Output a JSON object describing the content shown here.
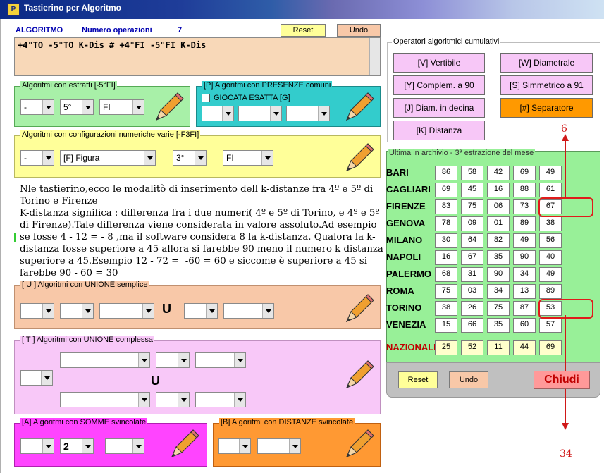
{
  "window": {
    "title": "Tastierino per Algoritmo",
    "icon_text": "P"
  },
  "header": {
    "algoritmo_label": "ALGORITMO",
    "numero_label": "Numero operazioni",
    "numero_value": "7",
    "reset_label": "Reset",
    "undo_label": "Undo"
  },
  "formula": "+4°TO -5°TO K-Dis # +4°FI -5°FI K-Dis",
  "cumulative": {
    "title": "Operatori algoritmici cumulativi",
    "buttons": [
      "[V] Vertibile",
      "[W] Diametrale",
      "[Y] Complem. a 90",
      "[S] Simmetrico  a 91",
      "[J] Diam. in decina",
      "[#] Separatore",
      "[K] Distanza"
    ]
  },
  "estratti": {
    "legend": "Algoritmi con estratti  [-5°FI]",
    "c1": "-",
    "c2": "5°",
    "c3": "FI"
  },
  "presenze": {
    "legend": "[P] Algoritmi con PRESENZE comuni",
    "checkbox_label": "GIOCATA ESATTA  [G]"
  },
  "config": {
    "legend": "Algoritmi con configurazioni numeriche varie  [-F3FI]",
    "c1": "-",
    "c2": "[F] Figura",
    "c3": "3°",
    "c4": "FI"
  },
  "note_text": "Nle tastierino,ecco le modalitò di inserimento dell k-distanze fra 4º e 5º di Torino e Firenze\nK-distanza significa : differenza fra i due numeri( 4º e 5º di Torino, e 4º e 5º di Firenze).Tale differenza viene considerata in valore assoluto.Ad esempio se fosse 4 - 12 = - 8 ,ma il software considera 8 la k-distanza. Qualora la k-distanza fosse superiore a 45 allora si farebbe 90 meno il numero k distanza superiore a 45.Esempio 12 - 72 =  -60 = 60 e siccome è superiore a 45 si farebbe 90 - 60 = 30",
  "unione": {
    "legend": "[ U ] Algoritmi con UNIONE semplice",
    "u_symbol": "U"
  },
  "unione_complessa": {
    "legend": "[ T ] Algoritmi con UNIONE complessa",
    "u_symbol": "U"
  },
  "somme": {
    "legend": "[A] Algoritmi con SOMME svincolate",
    "c2": "2"
  },
  "distanze": {
    "legend": "[B] Algoritmi con DISTANZE svincolate"
  },
  "archive": {
    "title": "Ultima in archivio - 3ª estrazione del mese",
    "rows": [
      {
        "city": "BARI",
        "nums": [
          "86",
          "58",
          "42",
          "69",
          "49"
        ]
      },
      {
        "city": "CAGLIARI",
        "nums": [
          "69",
          "45",
          "16",
          "88",
          "61"
        ]
      },
      {
        "city": "FIRENZE",
        "nums": [
          "83",
          "75",
          "06",
          "73",
          "67"
        ]
      },
      {
        "city": "GENOVA",
        "nums": [
          "78",
          "09",
          "01",
          "89",
          "38"
        ]
      },
      {
        "city": "MILANO",
        "nums": [
          "30",
          "64",
          "82",
          "49",
          "56"
        ]
      },
      {
        "city": "NAPOLI",
        "nums": [
          "16",
          "67",
          "35",
          "90",
          "40"
        ]
      },
      {
        "city": "PALERMO",
        "nums": [
          "68",
          "31",
          "90",
          "34",
          "49"
        ]
      },
      {
        "city": "ROMA",
        "nums": [
          "75",
          "03",
          "34",
          "13",
          "89"
        ]
      },
      {
        "city": "TORINO",
        "nums": [
          "38",
          "26",
          "75",
          "87",
          "53"
        ]
      },
      {
        "city": "VENEZIA",
        "nums": [
          "15",
          "66",
          "35",
          "60",
          "57"
        ]
      }
    ],
    "nazionale": {
      "city": "NAZIONALE",
      "nums": [
        "25",
        "52",
        "11",
        "44",
        "69"
      ]
    }
  },
  "bottom": {
    "reset_label": "Reset",
    "undo_label": "Undo",
    "chiudi_label": "Chiudi"
  },
  "annotations": {
    "top_number": "6",
    "bottom_number": "34"
  },
  "colors": {
    "accent_red": "#d01818",
    "nazionale_red": "#c00000",
    "archive_green": "#98f098",
    "panel_peach": "#f8c8a8",
    "panel_yellow": "#ffff99",
    "panel_cyan": "#33cccc",
    "panel_pink": "#f8c8f8",
    "panel_magenta": "#ff44ff",
    "panel_orange": "#ff9933",
    "separator_orange": "#ff9900"
  }
}
